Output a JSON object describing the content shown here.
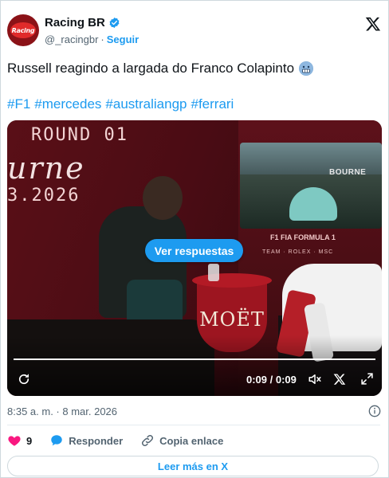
{
  "header": {
    "account_name": "Racing BR",
    "handle": "@_racingbr",
    "separator": "·",
    "follow_label": "Seguir",
    "avatar_text": "Racing"
  },
  "tweet": {
    "text": "Russell reagindo a largada do Franco Colapinto",
    "emoji": "grimacing-face-emoji",
    "hashtags": [
      "#F1",
      "#mercedes",
      "#australiangp",
      "#ferrari"
    ]
  },
  "video": {
    "scene_text_round": "ROUND 01",
    "scene_text_city": "urne",
    "scene_text_date": "3.2026",
    "screen_label": "BOURNE",
    "sponsor_text": "F1 FIA FORMULA 1",
    "sponsor_sub": "TEAM  ·  ROLEX  ·  MSC",
    "table_brand": "MOËT",
    "overlay_button": "Ver respuestas",
    "time_display": "0:09 / 0:09",
    "progress": 1.0,
    "controls": [
      "replay-icon",
      "volume-muted-icon",
      "x-logo-icon",
      "fullscreen-icon"
    ]
  },
  "meta": {
    "timestamp": "8:35 a. m. · 8 mar. 2026"
  },
  "actions": {
    "like_count": "9",
    "reply_label": "Responder",
    "copy_link_label": "Copia enlace"
  },
  "footer": {
    "read_more_label": "Leer más en X"
  },
  "colors": {
    "accent": "#1d9bf0",
    "text_primary": "#0f1419",
    "text_secondary": "#536471",
    "like": "#f91880",
    "border": "#cfd9de"
  }
}
